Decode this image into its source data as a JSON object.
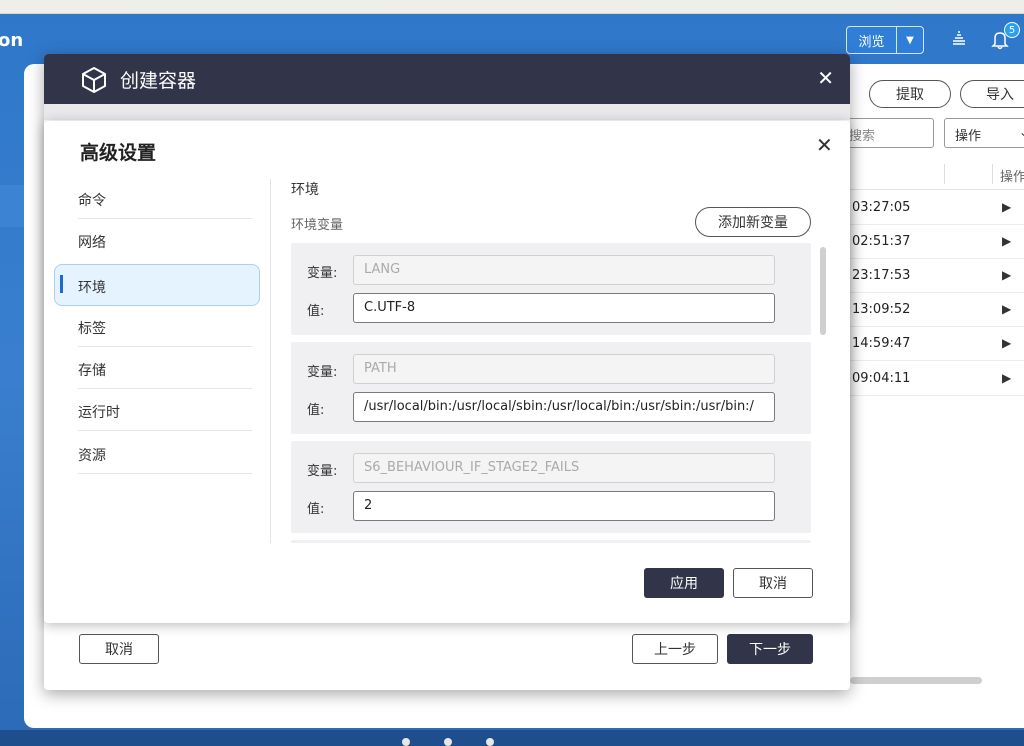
{
  "background": {
    "brand": "on",
    "browse_button": "浏览",
    "notification_count": "5",
    "extract_button": "提取",
    "import_button": "导入",
    "search_placeholder": "搜索",
    "operation_select": "操作",
    "column_operation": "操作",
    "rows": [
      {
        "time": "03:27:05"
      },
      {
        "time": "02:51:37"
      },
      {
        "time": "23:17:53"
      },
      {
        "time": "13:09:52"
      },
      {
        "time": "14:59:47"
      },
      {
        "time": "09:04:11"
      }
    ]
  },
  "create_dialog": {
    "title": "创建容器",
    "cancel": "取消",
    "prev_step": "上一步",
    "next_step": "下一步"
  },
  "advanced_dialog": {
    "title": "高级设置",
    "nav": [
      {
        "label": "命令"
      },
      {
        "label": "网络"
      },
      {
        "label": "环境",
        "active": true
      },
      {
        "label": "标签"
      },
      {
        "label": "存储"
      },
      {
        "label": "运行时"
      },
      {
        "label": "资源"
      }
    ],
    "section_title": "环境",
    "section_subtitle": "环境变量",
    "add_variable_button": "添加新变量",
    "variable_label": "变量:",
    "value_label": "值:",
    "env_vars": [
      {
        "key": "LANG",
        "value": "C.UTF-8"
      },
      {
        "key": "PATH",
        "value": "/usr/local/bin:/usr/local/sbin:/usr/local/bin:/usr/sbin:/usr/bin:/"
      },
      {
        "key": "S6_BEHAVIOUR_IF_STAGE2_FAILS",
        "value": "2"
      }
    ],
    "apply_button": "应用",
    "cancel_button": "取消"
  }
}
